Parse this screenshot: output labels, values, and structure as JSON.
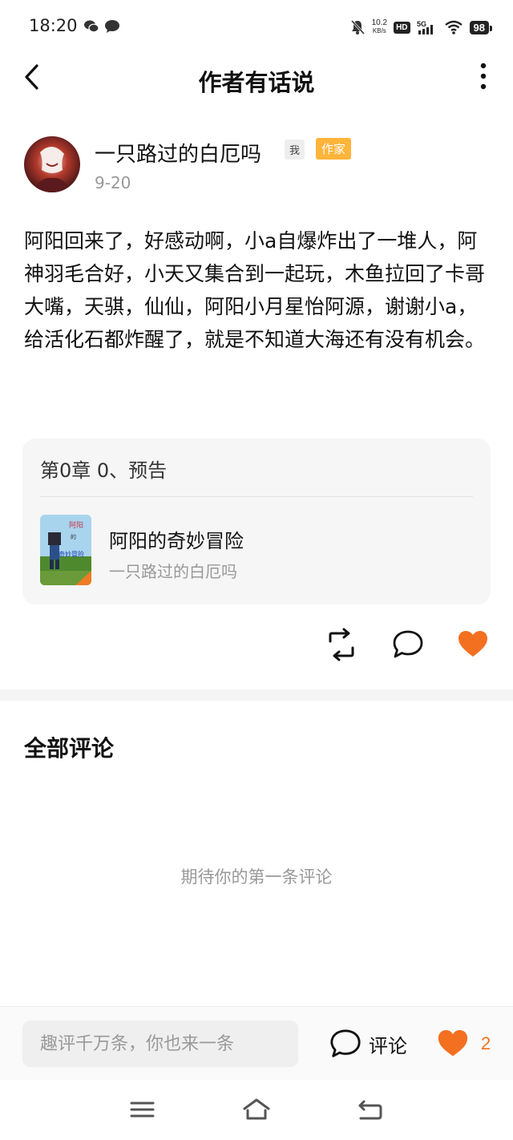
{
  "status_bar": {
    "time": "18:20",
    "net_speed_value": "10.2",
    "net_speed_unit": "KB/s",
    "hd": "HD",
    "signal": "5G",
    "battery": "98"
  },
  "header": {
    "title": "作者有话说"
  },
  "post": {
    "author_name": "一只路过的白厄吗",
    "tag_me": "我",
    "tag_writer": "作家",
    "date": "9-20",
    "body": "阿阳回来了，好感动啊，小a自爆炸出了一堆人，阿神羽毛合好，小天又集合到一起玩，木鱼拉回了卡哥大嘴，天骐，仙仙，阿阳小月星怡阿源，谢谢小a，给活化石都炸醒了，就是不知道大海还有没有机会。"
  },
  "chapter_card": {
    "chapter": "第0章  0、预告",
    "book_title": "阿阳的奇妙冒险",
    "book_author": "一只路过的白厄吗",
    "cover_text": [
      "阿阳",
      "的",
      "奇妙冒险"
    ]
  },
  "comments": {
    "title": "全部评论",
    "empty_text": "期待你的第一条评论"
  },
  "bottom_bar": {
    "input_placeholder": "趣评千万条，你也来一条",
    "comment_label": "评论",
    "like_count": "2"
  },
  "colors": {
    "accent": "#f37021",
    "tag_writer": "#ffb43a"
  }
}
